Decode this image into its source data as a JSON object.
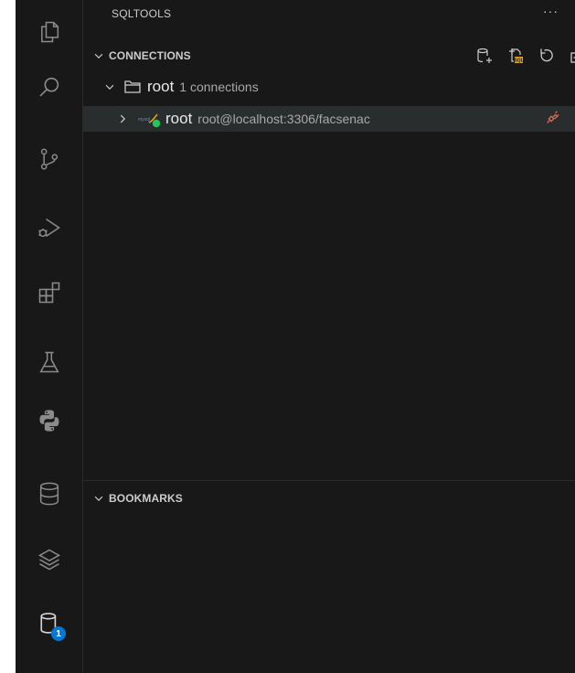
{
  "activity_bar": {
    "items": [
      {
        "icon": "explorer-icon"
      },
      {
        "icon": "search-icon"
      },
      {
        "icon": "source-control-icon"
      },
      {
        "icon": "run-debug-icon"
      },
      {
        "icon": "extensions-icon"
      },
      {
        "icon": "testing-icon"
      },
      {
        "icon": "python-icon"
      },
      {
        "icon": "database-icon"
      },
      {
        "icon": "layers-icon"
      },
      {
        "icon": "sqltools-icon",
        "badge": "1"
      }
    ],
    "badge_color": "#0078d4"
  },
  "sidebar": {
    "title": "SQLTOOLS",
    "more": "···",
    "connections": {
      "label": "CONNECTIONS",
      "actions": [
        {
          "icon": "add-connection-icon"
        },
        {
          "icon": "new-sql-file-icon"
        },
        {
          "icon": "refresh-icon"
        },
        {
          "icon": "collapse-all-icon"
        }
      ],
      "group": {
        "name": "root",
        "description": "1 connections"
      },
      "connection": {
        "name": "root",
        "description": "root@localhost:3306/facsenac",
        "status_color": "#22c55e",
        "disconnect_icon": "disconnect-plug-icon"
      }
    },
    "bookmarks": {
      "label": "BOOKMARKS"
    }
  },
  "colors": {
    "background": "#181818",
    "foreground": "#cccccc",
    "selection": "#2a2d2e",
    "accent_orange": "#e8a21a",
    "plug_red": "#e06c5c"
  }
}
